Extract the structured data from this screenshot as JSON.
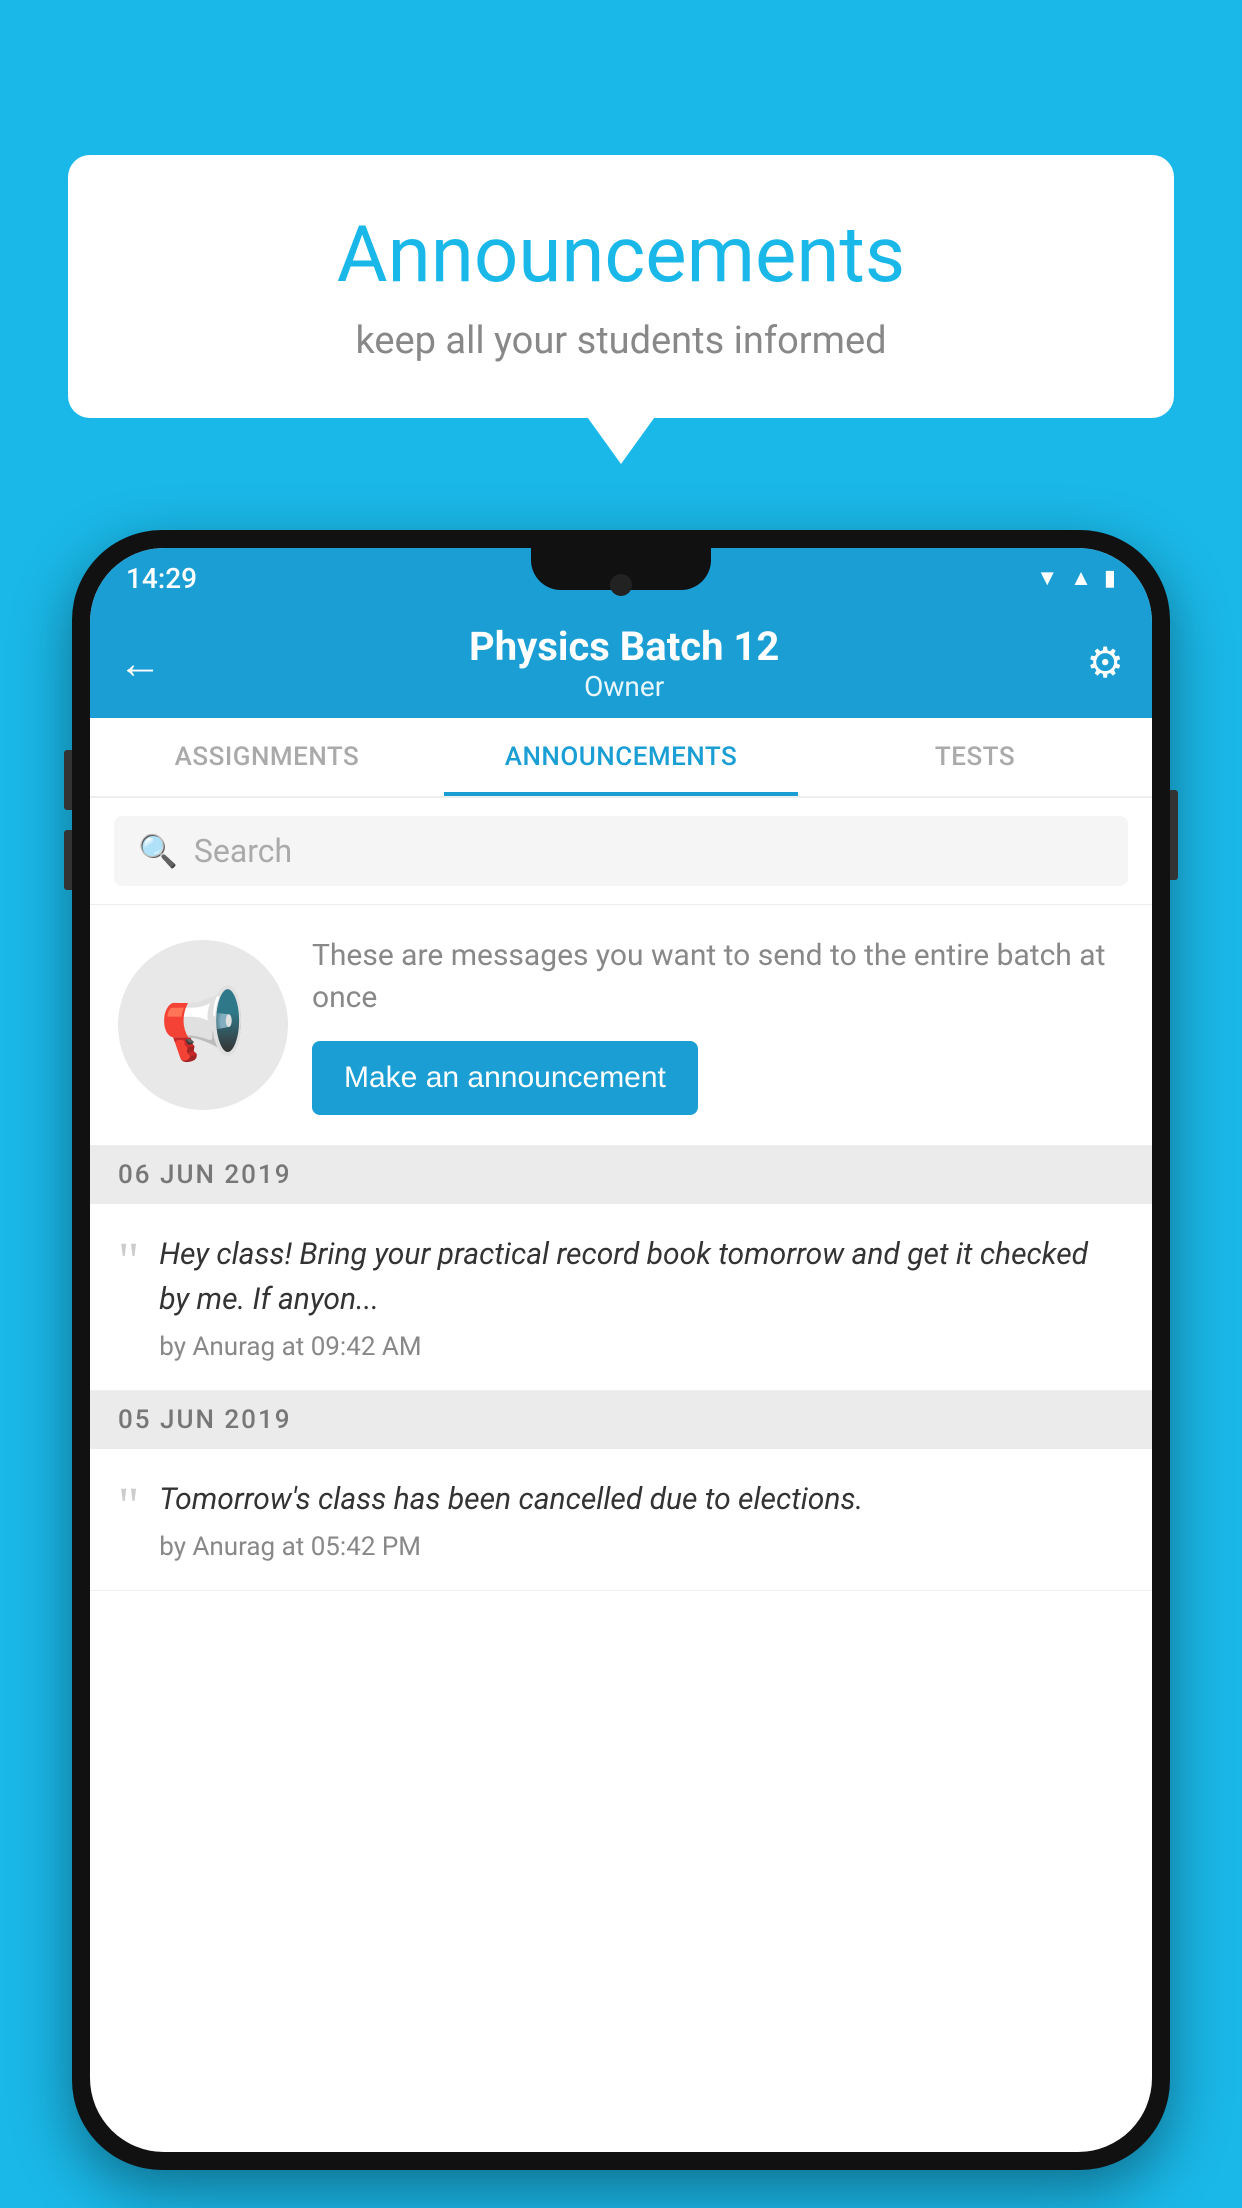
{
  "background_color": "#1ab8e8",
  "speech_bubble": {
    "title": "Announcements",
    "subtitle": "keep all your students informed"
  },
  "phone": {
    "status_bar": {
      "time": "14:29",
      "icons": [
        "wifi",
        "signal",
        "battery"
      ]
    },
    "app_bar": {
      "title": "Physics Batch 12",
      "subtitle": "Owner",
      "back_label": "←",
      "gear_label": "⚙"
    },
    "tabs": [
      {
        "label": "ASSIGNMENTS",
        "active": false
      },
      {
        "label": "ANNOUNCEMENTS",
        "active": true
      },
      {
        "label": "TESTS",
        "active": false
      }
    ],
    "search": {
      "placeholder": "Search"
    },
    "promo": {
      "description": "These are messages you want to send to the entire batch at once",
      "button_label": "Make an announcement"
    },
    "announcements": [
      {
        "date": "06  JUN  2019",
        "items": [
          {
            "text": "Hey class! Bring your practical record book tomorrow and get it checked by me. If anyon...",
            "meta": "by Anurag at 09:42 AM"
          }
        ]
      },
      {
        "date": "05  JUN  2019",
        "items": [
          {
            "text": "Tomorrow's class has been cancelled due to elections.",
            "meta": "by Anurag at 05:42 PM"
          }
        ]
      }
    ]
  }
}
